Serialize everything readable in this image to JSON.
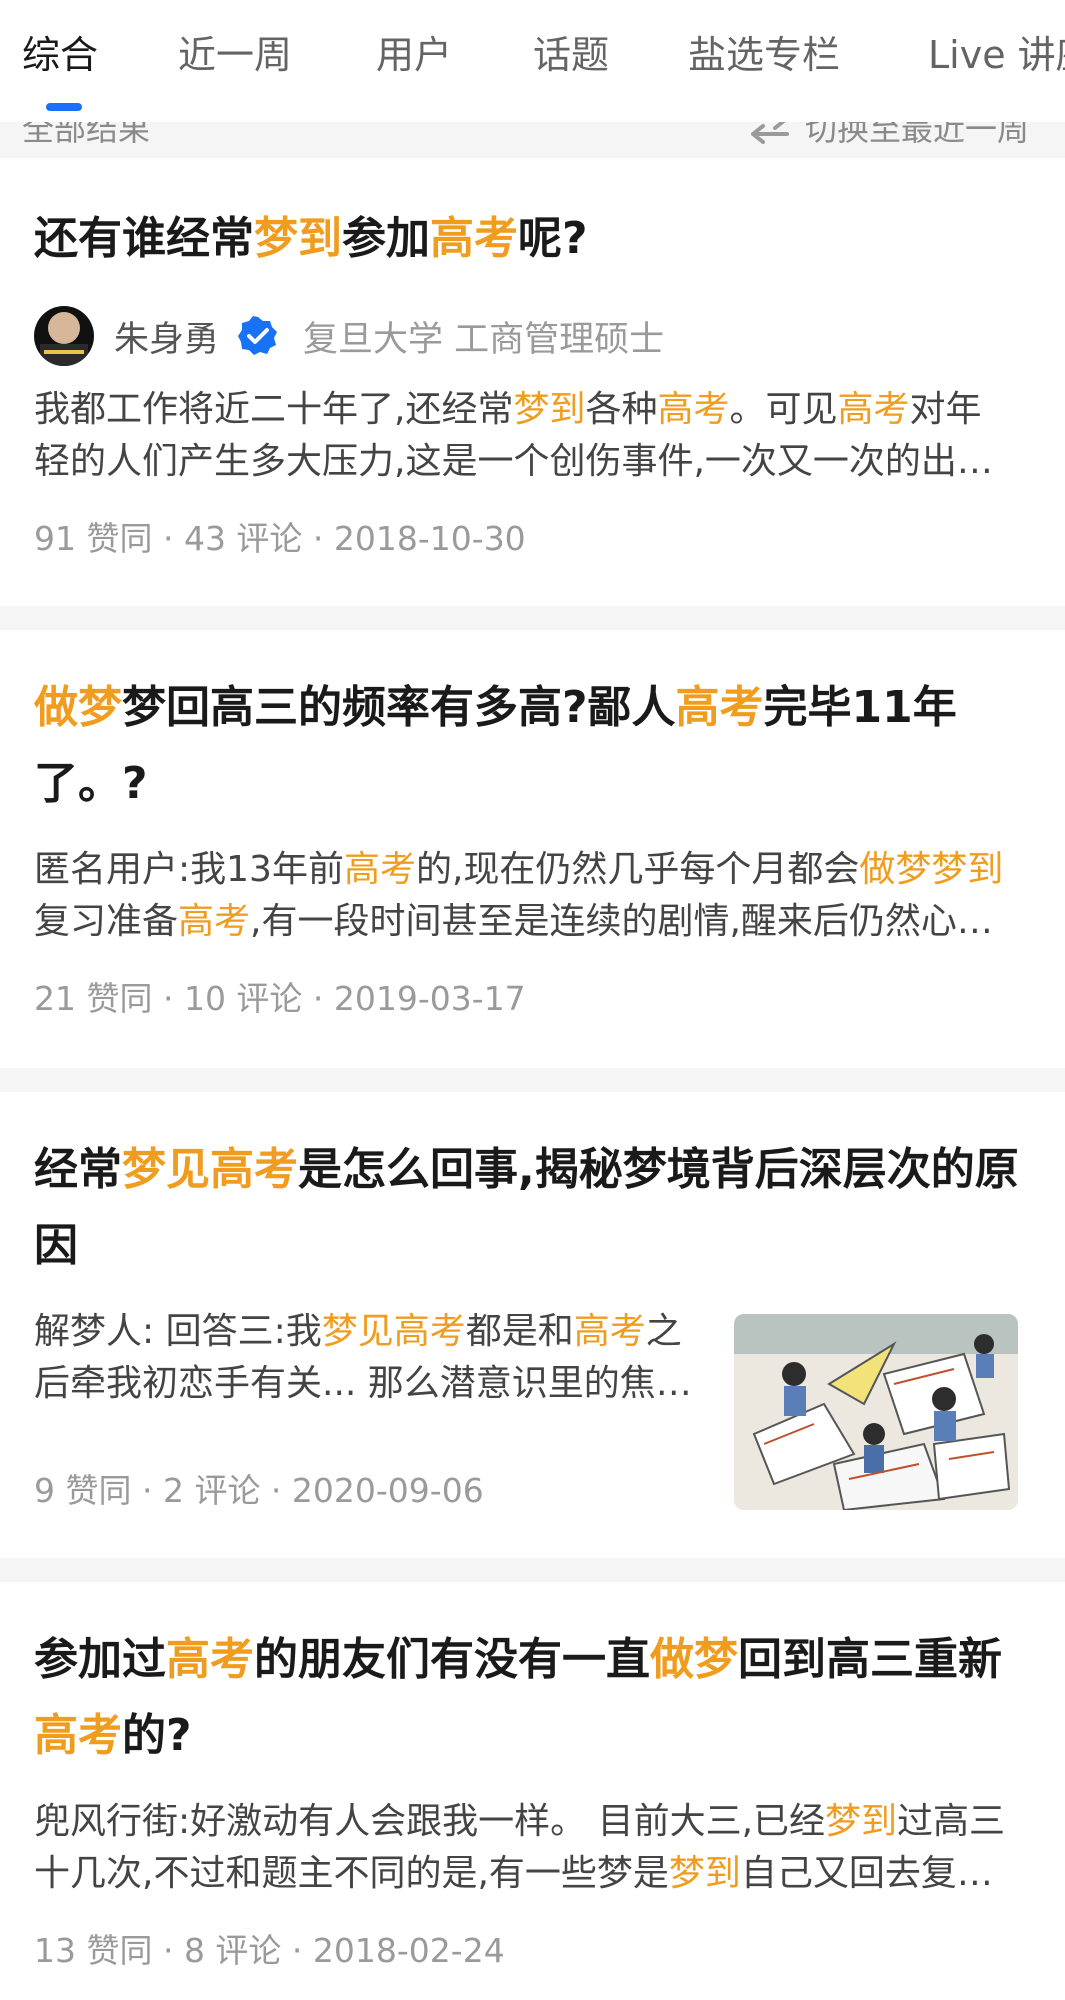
{
  "tabs": [
    "综合",
    "近一周",
    "用户",
    "话题",
    "盐选专栏",
    "Live 讲座"
  ],
  "active_tab": 0,
  "filter": {
    "left": "全部结果",
    "right": "切换至最近一周"
  },
  "cards": [
    {
      "title": [
        {
          "t": "还有谁经常"
        },
        {
          "t": "梦到",
          "hl": true
        },
        {
          "t": "参加"
        },
        {
          "t": "高考",
          "hl": true
        },
        {
          "t": "呢?"
        }
      ],
      "author": {
        "name": "朱身勇",
        "desc": "复旦大学 工商管理硕士"
      },
      "excerpt": [
        {
          "t": "我都工作将近二十年了,还经常"
        },
        {
          "t": "梦到",
          "hl": true
        },
        {
          "t": "各种"
        },
        {
          "t": "高考",
          "hl": true
        },
        {
          "t": "。可见"
        },
        {
          "t": "高考",
          "hl": true
        },
        {
          "t": "对年轻的人们产生多大压力,这是一个创伤事件,一次又一次的出现在梦中"
        }
      ],
      "meta": "91 赞同 · 43 评论 · 2018-10-30"
    },
    {
      "title": [
        {
          "t": "做梦",
          "hl": true
        },
        {
          "t": "梦回高三的频率有多高?鄙人"
        },
        {
          "t": "高考",
          "hl": true
        },
        {
          "t": "完毕11年了。?"
        }
      ],
      "excerpt": [
        {
          "t": "匿名用户:我13年前"
        },
        {
          "t": "高考",
          "hl": true
        },
        {
          "t": "的,现在仍然几乎每个月都会"
        },
        {
          "t": "做梦梦到",
          "hl": true
        },
        {
          "t": "复习准备"
        },
        {
          "t": "高考",
          "hl": true
        },
        {
          "t": ",有一段时间甚至是连续的剧情,醒来后仍然心有余悸"
        }
      ],
      "meta": "21 赞同 · 10 评论 · 2019-03-17"
    },
    {
      "title": [
        {
          "t": "经常"
        },
        {
          "t": "梦见高考",
          "hl": true
        },
        {
          "t": "是怎么回事,揭秘梦境背后深层次的原因"
        }
      ],
      "excerpt": [
        {
          "t": "解梦人: 回答三:我"
        },
        {
          "t": "梦见高考",
          "hl": true
        },
        {
          "t": "都是和"
        },
        {
          "t": "高考",
          "hl": true
        },
        {
          "t": "之后牵我初恋手有关... 那么潜意识里的焦虑与期待交织在一起"
        }
      ],
      "meta": "9 赞同 · 2 评论 · 2020-09-06"
    },
    {
      "title": [
        {
          "t": "参加过"
        },
        {
          "t": "高考",
          "hl": true
        },
        {
          "t": "的朋友们有没有一直"
        },
        {
          "t": "做梦",
          "hl": true
        },
        {
          "t": "回到高三重新"
        },
        {
          "t": "高考",
          "hl": true
        },
        {
          "t": "的?"
        }
      ],
      "excerpt": [
        {
          "t": "兜风行街:好激动有人会跟我一样。 目前大三,已经"
        },
        {
          "t": "梦到",
          "hl": true
        },
        {
          "t": "过高三十几次,不过和题主不同的是,有一些梦是"
        },
        {
          "t": "梦到",
          "hl": true
        },
        {
          "t": "自己又回去复读了"
        }
      ],
      "meta": "13 赞同 · 8 评论 · 2018-02-24"
    }
  ],
  "colors": {
    "highlight": "#f09d1f",
    "tab_indicator": "#1772f6",
    "verified_badge": "#1772f6",
    "separator": "#f5f5f5"
  },
  "icons": [
    "swap-arrows-icon",
    "verified-badge-icon"
  ]
}
